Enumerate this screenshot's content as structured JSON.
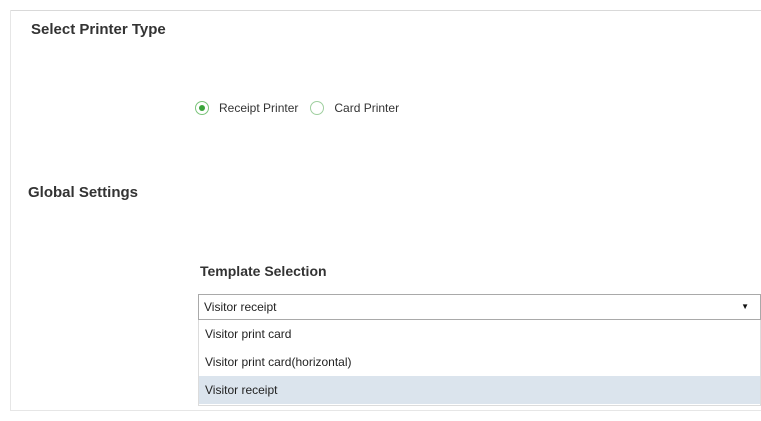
{
  "printer_type": {
    "title": "Select Printer Type",
    "options": [
      {
        "label": "Receipt Printer",
        "checked": true
      },
      {
        "label": "Card Printer",
        "checked": false
      }
    ]
  },
  "global_settings": {
    "title": "Global Settings",
    "template_label": "Template Selection",
    "selected_value": "Visitor receipt",
    "dropdown_icon": "triangle-down-icon",
    "options": [
      {
        "label": "Visitor print card",
        "highlighted": false
      },
      {
        "label": "Visitor print card(horizontal)",
        "highlighted": false
      },
      {
        "label": "Visitor receipt",
        "highlighted": true
      }
    ]
  },
  "colors": {
    "radio_accent": "#3aa43a",
    "highlight_row": "#dbe4ed"
  }
}
